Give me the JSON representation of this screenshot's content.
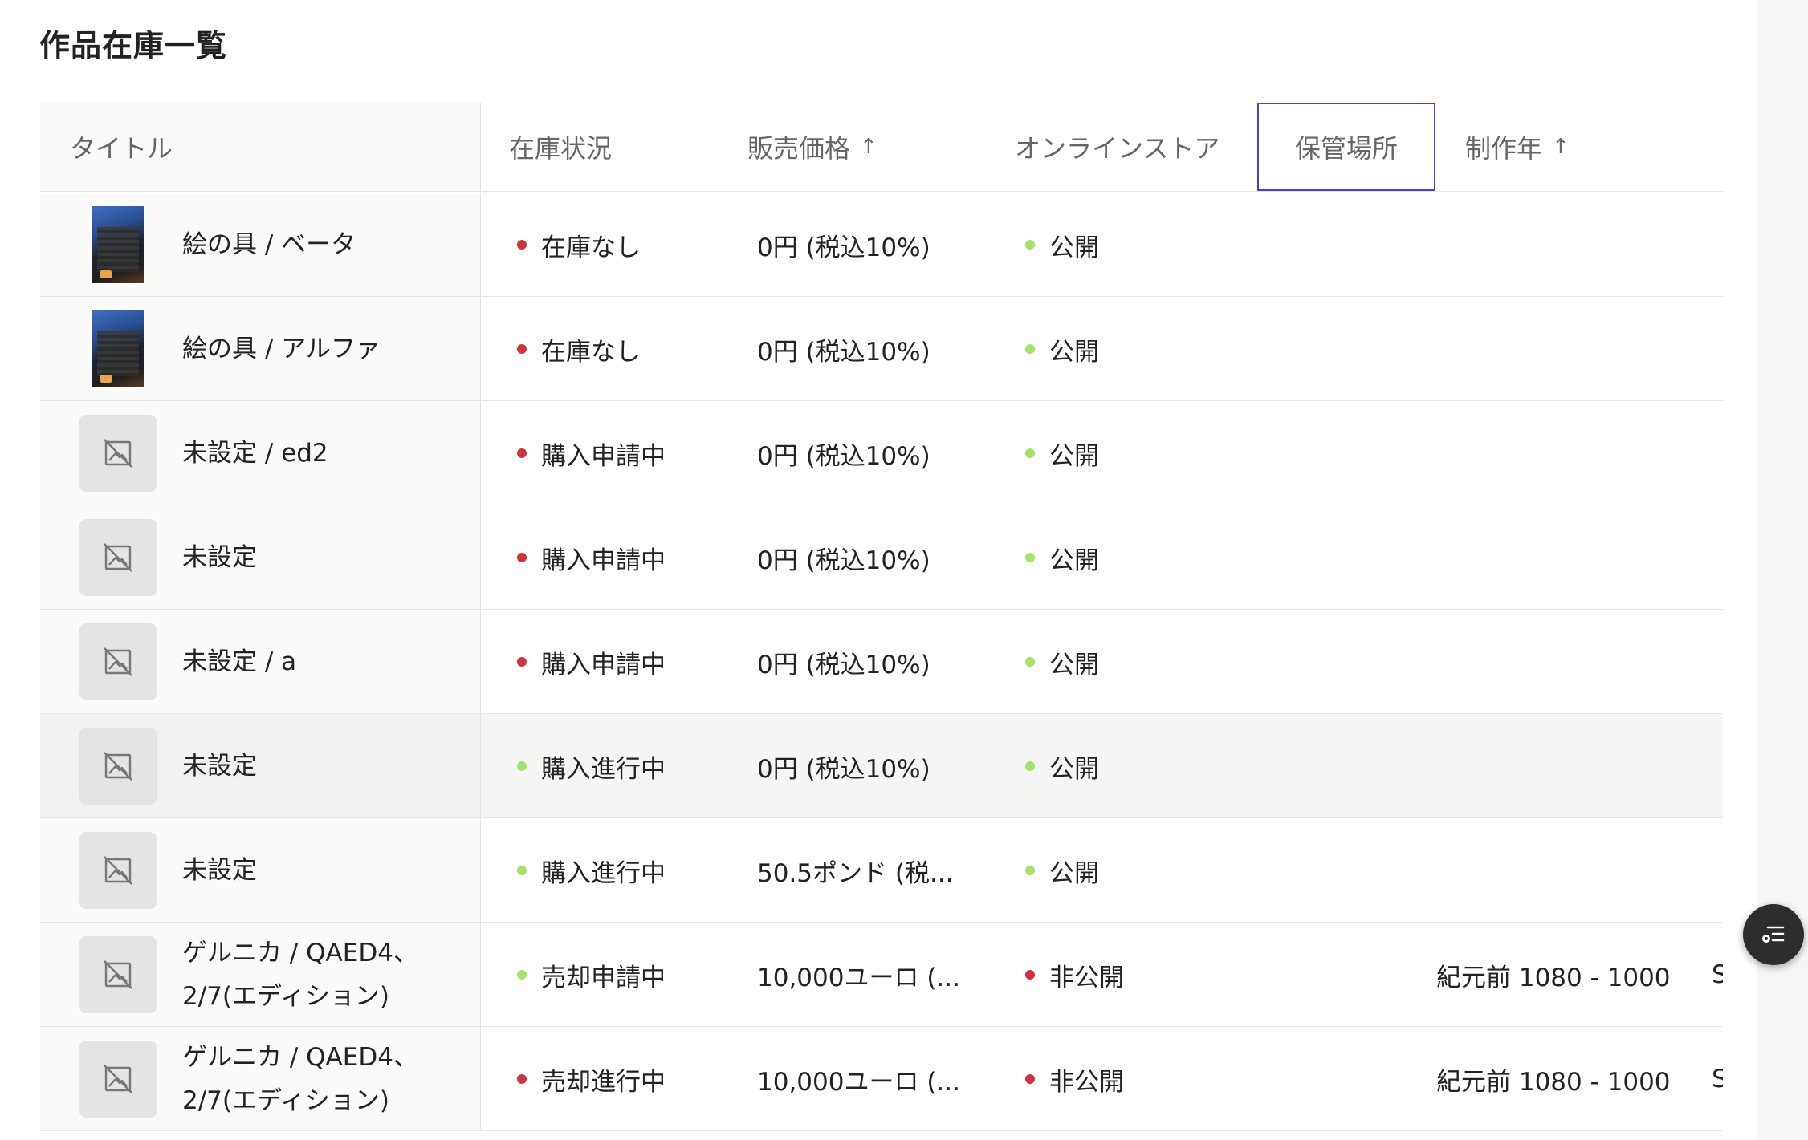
{
  "page": {
    "title": "作品在庫一覧"
  },
  "columns": [
    {
      "label": "タイトル",
      "sortable": false
    },
    {
      "label": "在庫状況",
      "sortable": false
    },
    {
      "label": "販売価格",
      "sortable": true,
      "arrow": "↑"
    },
    {
      "label": "オンラインストア",
      "sortable": false
    },
    {
      "label": "保管場所",
      "sortable": false,
      "focused": true
    },
    {
      "label": "制作年",
      "sortable": true,
      "arrow": "↑"
    }
  ],
  "rows": [
    {
      "thumb": "photo",
      "title": "絵の具 / ベータ",
      "stock": "在庫なし",
      "stock_color": "red",
      "price": "0円 (税込10%)",
      "store": "公開",
      "store_color": "green",
      "location": "",
      "year": "",
      "extra": ""
    },
    {
      "thumb": "photo",
      "title": "絵の具 / アルファ",
      "stock": "在庫なし",
      "stock_color": "red",
      "price": "0円 (税込10%)",
      "store": "公開",
      "store_color": "green",
      "location": "",
      "year": "",
      "extra": ""
    },
    {
      "thumb": "placeholder",
      "title": "未設定 / ed2",
      "stock": "購入申請中",
      "stock_color": "red",
      "price": "0円 (税込10%)",
      "store": "公開",
      "store_color": "green",
      "location": "",
      "year": "",
      "extra": ""
    },
    {
      "thumb": "placeholder",
      "title": "未設定",
      "stock": "購入申請中",
      "stock_color": "red",
      "price": "0円 (税込10%)",
      "store": "公開",
      "store_color": "green",
      "location": "",
      "year": "",
      "extra": ""
    },
    {
      "thumb": "placeholder",
      "title": "未設定 / a",
      "stock": "購入申請中",
      "stock_color": "red",
      "price": "0円 (税込10%)",
      "store": "公開",
      "store_color": "green",
      "location": "",
      "year": "",
      "extra": ""
    },
    {
      "thumb": "placeholder",
      "title": "未設定",
      "stock": "購入進行中",
      "stock_color": "green",
      "price": "0円 (税込10%)",
      "store": "公開",
      "store_color": "green",
      "location": "",
      "year": "",
      "extra": "",
      "hovered": true
    },
    {
      "thumb": "placeholder",
      "title": "未設定",
      "stock": "購入進行中",
      "stock_color": "green",
      "price": "50.5ポンド (税...",
      "store": "公開",
      "store_color": "green",
      "location": "",
      "year": "",
      "extra": ""
    },
    {
      "thumb": "placeholder",
      "title": "ゲルニカ / QAED4、2/7(エディション)",
      "stock": "売却申請中",
      "stock_color": "green",
      "price": "10,000ユーロ (...",
      "store": "非公開",
      "store_color": "red",
      "location": "",
      "year": "紀元前 1080 - 1000",
      "extra": "S"
    },
    {
      "thumb": "placeholder",
      "title": "ゲルニカ / QAED4、2/7(エディション)",
      "stock": "売却進行中",
      "stock_color": "red",
      "price": "10,000ユーロ (...",
      "store": "非公開",
      "store_color": "red",
      "location": "",
      "year": "紀元前 1080 - 1000",
      "extra": "S"
    }
  ],
  "colors": {
    "accent": "#4f3bd8",
    "red_dot": "#d0343a",
    "green_dot": "#a4e26a"
  },
  "fab": {
    "icon": "filter-list-icon"
  }
}
